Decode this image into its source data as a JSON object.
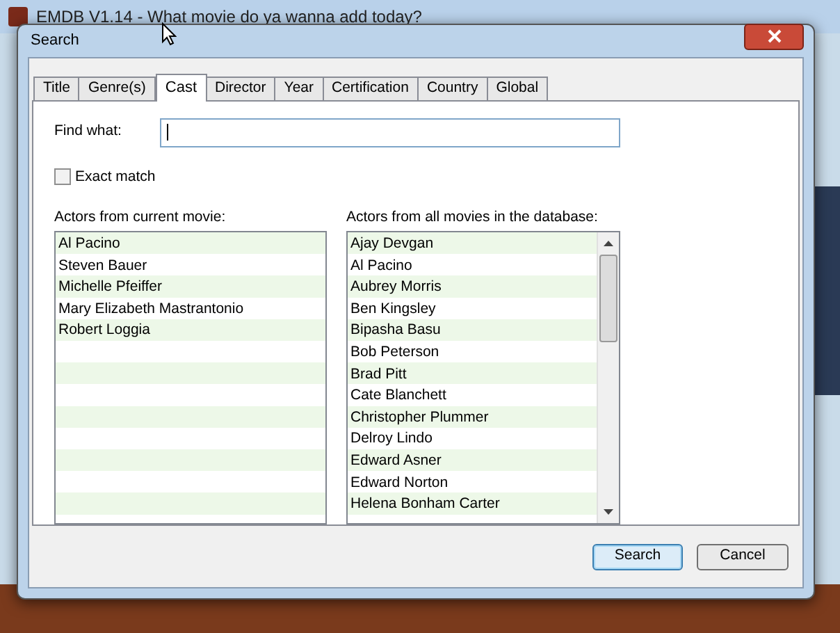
{
  "app_window": {
    "title": "EMDB V1.14 - What movie do ya wanna add today?"
  },
  "dialog": {
    "title": "Search",
    "tabs": [
      {
        "label": "Title",
        "selected": false
      },
      {
        "label": "Genre(s)",
        "selected": false
      },
      {
        "label": "Cast",
        "selected": true
      },
      {
        "label": "Director",
        "selected": false
      },
      {
        "label": "Year",
        "selected": false
      },
      {
        "label": "Certification",
        "selected": false
      },
      {
        "label": "Country",
        "selected": false
      },
      {
        "label": "Global",
        "selected": false
      }
    ],
    "find_label": "Find what:",
    "exact_match": {
      "label": "Exact match",
      "checked": false
    },
    "current_list": {
      "label": "Actors from current movie:",
      "items": [
        "Al Pacino",
        "Steven Bauer",
        "Michelle Pfeiffer",
        "Mary Elizabeth Mastrantonio",
        "Robert Loggia"
      ]
    },
    "all_list": {
      "label": "Actors from all movies in the database:",
      "items": [
        "Ajay Devgan",
        "Al Pacino",
        "Aubrey Morris",
        "Ben Kingsley",
        "Bipasha Basu",
        "Bob Peterson",
        "Brad Pitt",
        "Cate Blanchett",
        "Christopher Plummer",
        "Delroy Lindo",
        "Edward Asner",
        "Edward Norton",
        "Helena Bonham Carter"
      ]
    },
    "buttons": [
      "Search",
      "Cancel"
    ]
  }
}
